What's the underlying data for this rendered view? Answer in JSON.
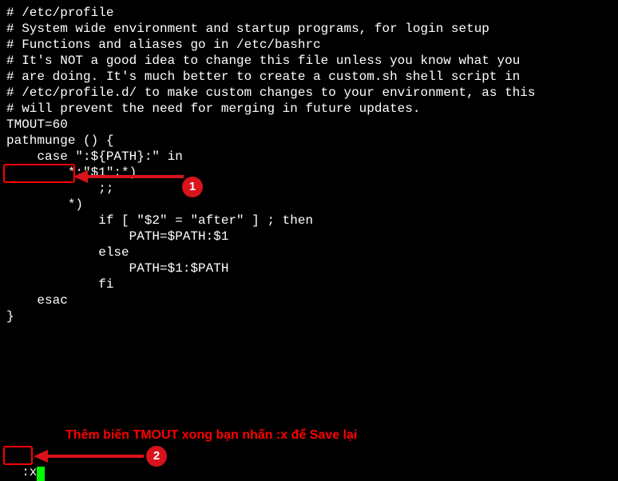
{
  "editor": {
    "lines": {
      "l0": "# /etc/profile",
      "l1": "",
      "l2": "# System wide environment and startup programs, for login setup",
      "l3": "# Functions and aliases go in /etc/bashrc",
      "l4": "",
      "l5": "# It's NOT a good idea to change this file unless you know what you",
      "l6": "# are doing. It's much better to create a custom.sh shell script in",
      "l7": "# /etc/profile.d/ to make custom changes to your environment, as this",
      "l8": "# will prevent the need for merging in future updates.",
      "l9": "TMOUT=60",
      "l10": "pathmunge () {",
      "l11": "    case \":${PATH}:\" in",
      "l12": "        *:\"$1\":*)",
      "l13": "            ;;",
      "l14": "        *)",
      "l15": "            if [ \"$2\" = \"after\" ] ; then",
      "l16": "                PATH=$PATH:$1",
      "l17": "            else",
      "l18": "                PATH=$1:$PATH",
      "l19": "            fi",
      "l20": "    esac",
      "l21": "}"
    },
    "command": ":x"
  },
  "annotations": {
    "badge1": "1",
    "badge2": "2",
    "note": "Thêm biến TMOUT xong bạn nhấn :x để Save lại"
  }
}
